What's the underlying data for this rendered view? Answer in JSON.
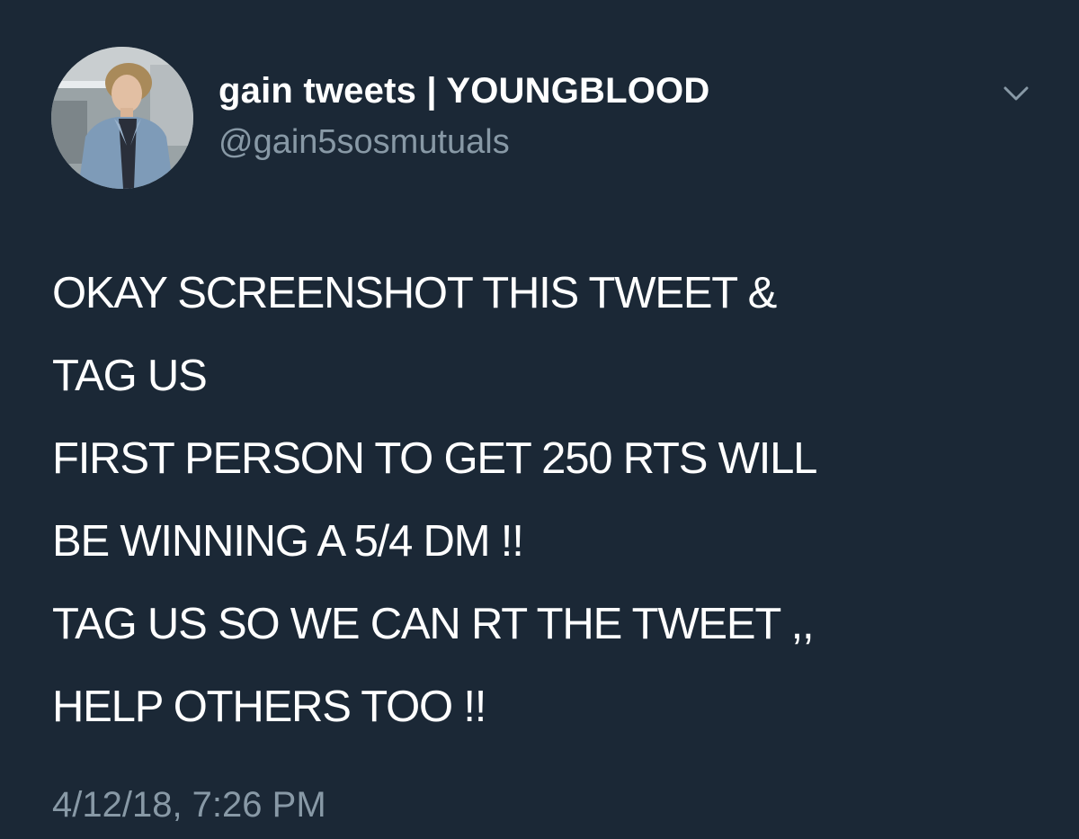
{
  "tweet": {
    "display_name": "gain tweets | YOUNGBLOOD",
    "handle": "@gain5sosmutuals",
    "body_lines": [
      "OKAY SCREENSHOT THIS TWEET &",
      "TAG US",
      "FIRST PERSON TO GET 250 RTS WILL",
      "BE WINNING A 5/4 DM !!",
      "TAG US SO WE CAN RT THE TWEET ,,",
      "HELP OTHERS TOO !!"
    ],
    "timestamp": "4/12/18, 7:26 PM"
  },
  "icons": {
    "menu": "chevron-down-icon",
    "avatar": "profile-photo"
  },
  "colors": {
    "background": "#1b2836",
    "primary_text": "#ffffff",
    "secondary_text": "#8899a6"
  }
}
